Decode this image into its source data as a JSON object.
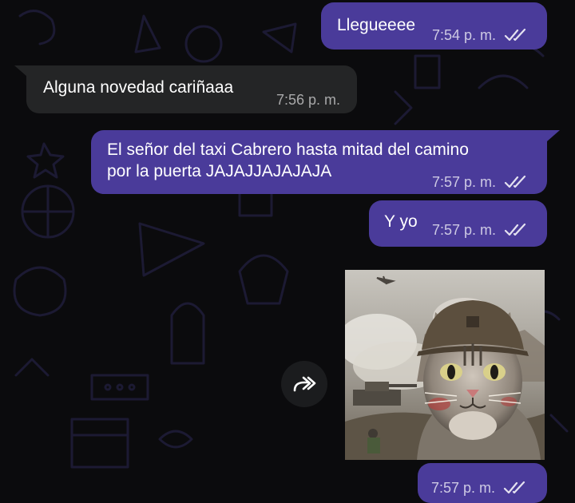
{
  "messages": [
    {
      "direction": "out",
      "text": "Llegueeee",
      "time": "7:54 p. m.",
      "status": "read"
    },
    {
      "direction": "in",
      "text": "Alguna novedad cariñaaa",
      "time": "7:56 p. m."
    },
    {
      "direction": "out",
      "lines": [
        "El señor del taxi Cabrero hasta mitad del camino",
        "por la puerta JAJAJJAJAJAJA"
      ],
      "time": "7:57 p. m.",
      "status": "read"
    },
    {
      "direction": "out",
      "text": "Y yo",
      "time": "7:57 p. m.",
      "status": "read"
    },
    {
      "direction": "out",
      "type": "image",
      "image": "cat-soldier-helmet-battlefield-meme",
      "status": "read"
    },
    {
      "direction": "out",
      "time": "7:57 p. m.",
      "status": "read"
    }
  ],
  "icons": {
    "forward": "forward-icon",
    "read_receipt": "double-check-icon"
  },
  "colors": {
    "background": "#0b0b0d",
    "outgoing_bubble": "#4a3b9a",
    "incoming_bubble": "#242526",
    "text": "#ffffff"
  }
}
